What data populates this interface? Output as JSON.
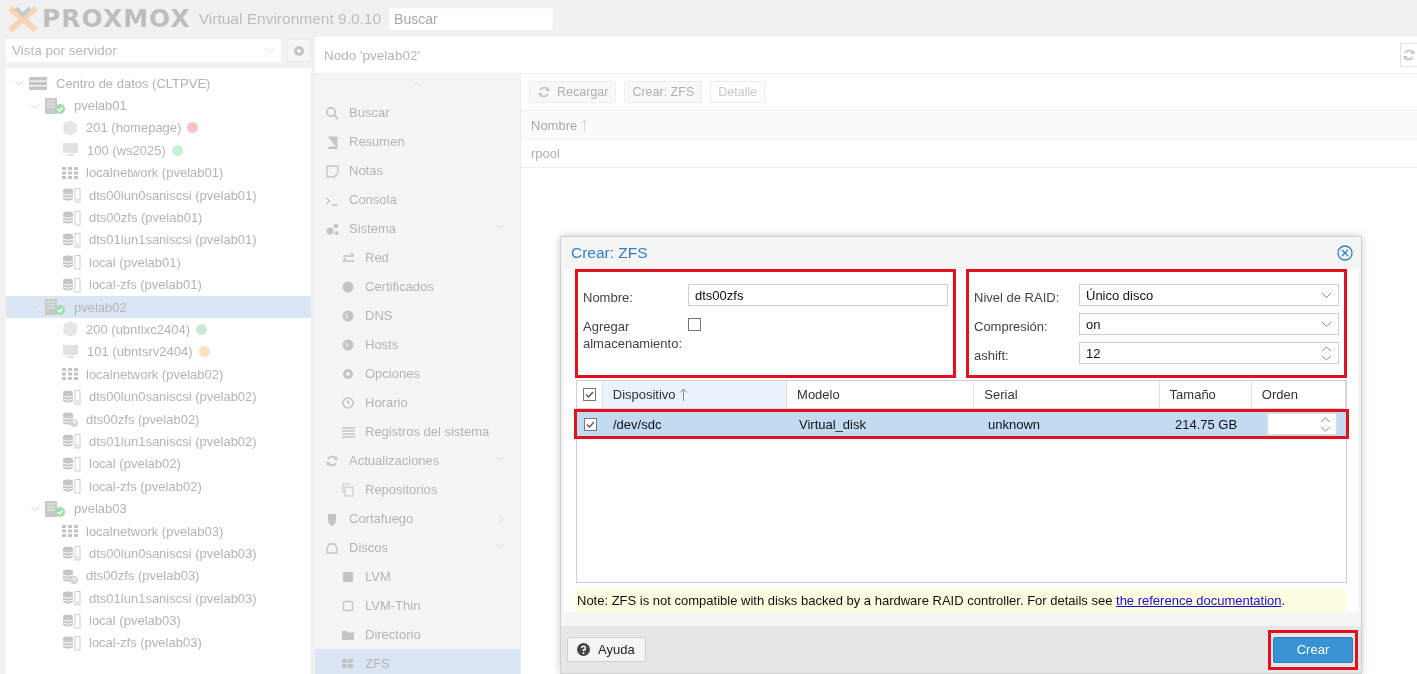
{
  "header": {
    "logo": "PROXMOX",
    "product": "Virtual Environment 9.0.10",
    "search": {
      "placeholder": "Buscar"
    }
  },
  "view_selector": {
    "value": "Vista por servidor"
  },
  "tree": [
    {
      "label": "Centro de datos (CLTPVE)",
      "kind": "datacenter",
      "selected": false,
      "expanded": true,
      "children": [
        {
          "label": "pvelab01",
          "kind": "node",
          "selected": false,
          "expanded": true,
          "children": [
            {
              "label": "201 (homepage)",
              "kind": "ct",
              "selected": false,
              "color": "#f6c3c3"
            },
            {
              "label": "100 (ws2025)",
              "kind": "vm",
              "selected": false,
              "color": "#c9efd6"
            },
            {
              "label": "localnetwork (pvelab01)",
              "kind": "sdn",
              "selected": false
            },
            {
              "label": "dts00lun0saniscsi (pvelab01)",
              "kind": "storage-device",
              "selected": false
            },
            {
              "label": "dts00zfs (pvelab01)",
              "kind": "storage",
              "selected": false
            },
            {
              "label": "dts01lun1saniscsi (pvelab01)",
              "kind": "storage-device",
              "selected": false
            },
            {
              "label": "local (pvelab01)",
              "kind": "storage",
              "selected": false
            },
            {
              "label": "local-zfs (pvelab01)",
              "kind": "storage",
              "selected": false
            }
          ]
        },
        {
          "label": "pvelab02",
          "kind": "node",
          "selected": true,
          "expanded": true,
          "children": [
            {
              "label": "200 (ubntlxc2404)",
              "kind": "ct",
              "selected": false,
              "color": "#cfe6d3"
            },
            {
              "label": "101 (ubntsrv2404)",
              "kind": "vm",
              "selected": false,
              "color": "#fde1c0"
            },
            {
              "label": "localnetwork (pvelab02)",
              "kind": "sdn",
              "selected": false
            },
            {
              "label": "dts00lun0saniscsi (pvelab02)",
              "kind": "storage-device",
              "selected": false
            },
            {
              "label": "dts00zfs (pvelab02)",
              "kind": "storage-unknown",
              "selected": false
            },
            {
              "label": "dts01lun1saniscsi (pvelab02)",
              "kind": "storage-device",
              "selected": false
            },
            {
              "label": "local (pvelab02)",
              "kind": "storage",
              "selected": false
            },
            {
              "label": "local-zfs (pvelab02)",
              "kind": "storage",
              "selected": false
            }
          ]
        },
        {
          "label": "pvelab03",
          "kind": "node",
          "selected": false,
          "expanded": true,
          "children": [
            {
              "label": "localnetwork (pvelab03)",
              "kind": "sdn",
              "selected": false
            },
            {
              "label": "dts00lun0saniscsi (pvelab03)",
              "kind": "storage-device",
              "selected": false
            },
            {
              "label": "dts00zfs (pvelab03)",
              "kind": "storage-unknown",
              "selected": false
            },
            {
              "label": "dts01lun1saniscsi (pvelab03)",
              "kind": "storage-device",
              "selected": false
            },
            {
              "label": "local (pvelab03)",
              "kind": "storage",
              "selected": false
            },
            {
              "label": "local-zfs (pvelab03)",
              "kind": "storage",
              "selected": false
            }
          ]
        }
      ]
    }
  ],
  "node_title": "Nodo 'pvelab02'",
  "nav": [
    {
      "label": "Buscar",
      "selected": false
    },
    {
      "label": "Resumen",
      "selected": false
    },
    {
      "label": "Notas",
      "selected": false
    },
    {
      "label": "Consola",
      "selected": false
    },
    {
      "label": "Sistema",
      "selected": false,
      "expanded": true,
      "children": [
        {
          "label": "Red",
          "selected": false
        },
        {
          "label": "Certificados",
          "selected": false
        },
        {
          "label": "DNS",
          "selected": false
        },
        {
          "label": "Hosts",
          "selected": false
        },
        {
          "label": "Opciones",
          "selected": false
        },
        {
          "label": "Horario",
          "selected": false
        },
        {
          "label": "Registros del sistema",
          "selected": false
        }
      ]
    },
    {
      "label": "Actualizaciones",
      "selected": false,
      "expanded": true,
      "children": [
        {
          "label": "Repositorios",
          "selected": false
        }
      ]
    },
    {
      "label": "Cortafuego",
      "selected": false,
      "expanded": false
    },
    {
      "label": "Discos",
      "selected": false,
      "expanded": true,
      "children": [
        {
          "label": "LVM",
          "selected": false
        },
        {
          "label": "LVM-Thin",
          "selected": false
        },
        {
          "label": "Directorio",
          "selected": false
        },
        {
          "label": "ZFS",
          "selected": true
        }
      ]
    }
  ],
  "toolbar": [
    {
      "label": "Recargar",
      "disabled": false
    },
    {
      "label": "Crear: ZFS",
      "disabled": false
    },
    {
      "label": "Detalle",
      "disabled": true
    }
  ],
  "pool_table": {
    "columns": [
      {
        "label": "Nombre",
        "sorted": true
      }
    ],
    "rows": [
      "rpool"
    ]
  },
  "dialog": {
    "title": "Crear: ZFS",
    "left_fields": {
      "highlighted": true,
      "fields": [
        {
          "kind": "text",
          "label": "Nombre:",
          "value": "dts00zfs"
        },
        {
          "kind": "checkbox",
          "label": "Agregar almacenamiento:",
          "checked": false
        }
      ]
    },
    "right_fields": {
      "highlighted": true,
      "fields": [
        {
          "kind": "combo",
          "label": "Nivel de RAID:",
          "value": "Único disco"
        },
        {
          "kind": "combo",
          "label": "Compresión:",
          "value": "on"
        },
        {
          "kind": "spinner",
          "label": "ashift:",
          "value": "12"
        }
      ]
    },
    "disks": {
      "all_checked": true,
      "columns": [
        {
          "label": "Dispositivo",
          "sorted": true
        },
        {
          "label": "Modelo",
          "sorted": false
        },
        {
          "label": "Serial",
          "sorted": false
        },
        {
          "label": "Tamaño",
          "sorted": false
        },
        {
          "label": "Orden",
          "sorted": false
        }
      ],
      "rows": [
        {
          "selected": true,
          "checked": true,
          "highlighted": true,
          "device": "/dev/sdc",
          "model": "Virtual_disk",
          "serial": "unknown",
          "size": "214.75 GB"
        }
      ]
    },
    "note": "Note: ZFS is not compatible with disks backed by a hardware RAID controller. For details see ",
    "note_link": "the reference documentation",
    "note_end": ".",
    "help_button": "Ayuda",
    "create_button": {
      "label": "Crear",
      "highlighted": true
    }
  }
}
